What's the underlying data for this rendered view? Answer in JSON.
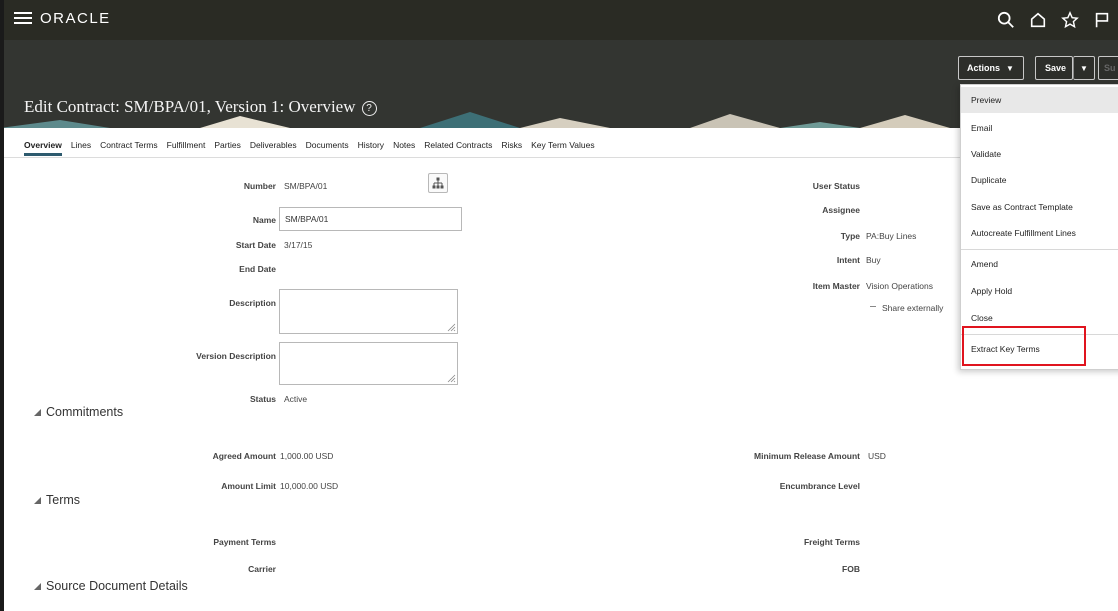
{
  "header": {
    "logo": "ORACLE",
    "icons": [
      "search-icon",
      "home-icon",
      "favorites-star-icon",
      "flag-icon"
    ]
  },
  "title": {
    "text": "Edit Contract: SM/BPA/01, Version 1: Overview",
    "help_icon": "?"
  },
  "toolbar": {
    "actions_label": "Actions",
    "save_label": "Save",
    "submit_label": "Su"
  },
  "tabs": [
    {
      "label": "Overview",
      "active": true
    },
    {
      "label": "Lines"
    },
    {
      "label": "Contract Terms"
    },
    {
      "label": "Fulfillment"
    },
    {
      "label": "Parties"
    },
    {
      "label": "Deliverables"
    },
    {
      "label": "Documents"
    },
    {
      "label": "History"
    },
    {
      "label": "Notes"
    },
    {
      "label": "Related Contracts"
    },
    {
      "label": "Risks"
    },
    {
      "label": "Key Term Values"
    }
  ],
  "overview": {
    "number_label": "Number",
    "number_value": "SM/BPA/01",
    "name_label": "Name",
    "name_value": "SM/BPA/01",
    "start_date_label": "Start Date",
    "start_date_value": "3/17/15",
    "end_date_label": "End Date",
    "description_label": "Description",
    "version_description_label": "Version Description",
    "status_label": "Status",
    "status_value": "Active",
    "user_status_label": "User Status",
    "assignee_label": "Assignee",
    "type_label": "Type",
    "type_value": "PA:Buy Lines",
    "intent_label": "Intent",
    "intent_value": "Buy",
    "item_master_label": "Item Master",
    "item_master_value": "Vision Operations",
    "share_externally_label": "Share externally"
  },
  "commitments": {
    "heading": "Commitments",
    "agreed_amount_label": "Agreed Amount",
    "agreed_amount_value": "1,000.00",
    "agreed_amount_currency": "USD",
    "amount_limit_label": "Amount Limit",
    "amount_limit_value": "10,000.00",
    "amount_limit_currency": "USD",
    "min_release_label": "Minimum Release Amount",
    "min_release_currency": "USD",
    "encumbrance_label": "Encumbrance Level"
  },
  "terms": {
    "heading": "Terms",
    "payment_terms_label": "Payment Terms",
    "carrier_label": "Carrier",
    "freight_terms_label": "Freight Terms",
    "fob_label": "FOB"
  },
  "source_document": {
    "heading": "Source Document Details"
  },
  "actions_menu": {
    "items": [
      "Preview",
      "Email",
      "Validate",
      "Duplicate",
      "Save as Contract Template",
      "Autocreate Fulfillment Lines",
      "Amend",
      "Apply Hold",
      "Close",
      "Extract Key Terms"
    ],
    "highlighted_item": "Preview",
    "outlined_item": "Extract Key Terms",
    "outline_color": "#e0141e"
  },
  "colors": {
    "header_bg": "#2a2b24",
    "title_band_bg": "#333531",
    "active_tab_underline": "#2d5a6e"
  }
}
